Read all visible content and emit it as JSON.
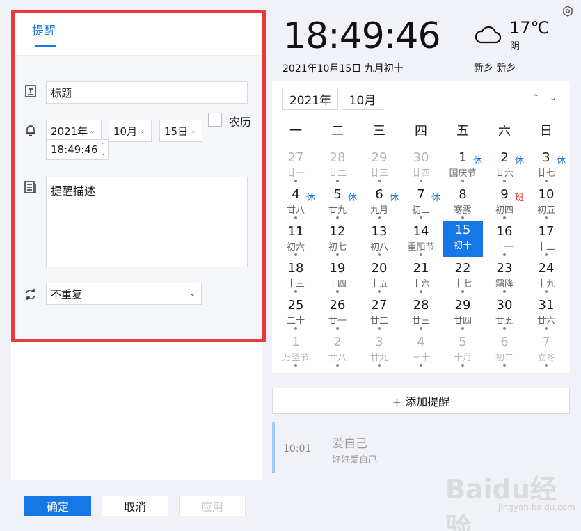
{
  "left": {
    "tab_label": "提醒",
    "title_value": "标题",
    "year_select": "2021年",
    "month_select": "10月",
    "day_select": "15日",
    "lunar_label": "农历",
    "time_value": "18:49:46",
    "description_value": "提醒描述",
    "repeat_value": "不重复"
  },
  "buttons": {
    "ok": "确定",
    "cancel": "取消",
    "apply": "应用"
  },
  "header": {
    "time": "18:49:46",
    "date": "2021年10月15日 九月初十",
    "temperature": "17℃",
    "weather": "阴",
    "location": "新乡 新乡"
  },
  "calendar": {
    "year": "2021年",
    "month": "10月",
    "weekdays": [
      "一",
      "二",
      "三",
      "四",
      "五",
      "六",
      "日"
    ],
    "days": [
      {
        "n": "27",
        "l": "廿一",
        "dim": true
      },
      {
        "n": "28",
        "l": "廿二",
        "dim": true
      },
      {
        "n": "29",
        "l": "廿三",
        "dim": true
      },
      {
        "n": "30",
        "l": "廿四",
        "dim": true
      },
      {
        "n": "1",
        "l": "国庆节",
        "tag": "休"
      },
      {
        "n": "2",
        "l": "廿六",
        "tag": "休"
      },
      {
        "n": "3",
        "l": "廿七",
        "tag": "休"
      },
      {
        "n": "4",
        "l": "廿八",
        "tag": "休"
      },
      {
        "n": "5",
        "l": "廿九",
        "tag": "休"
      },
      {
        "n": "6",
        "l": "九月",
        "tag": "休"
      },
      {
        "n": "7",
        "l": "初二",
        "tag": "休"
      },
      {
        "n": "8",
        "l": "寒露"
      },
      {
        "n": "9",
        "l": "初四",
        "tag": "班",
        "tag_color": "#e83a3a"
      },
      {
        "n": "10",
        "l": "初五"
      },
      {
        "n": "11",
        "l": "初六"
      },
      {
        "n": "12",
        "l": "初七"
      },
      {
        "n": "13",
        "l": "初八"
      },
      {
        "n": "14",
        "l": "重阳节"
      },
      {
        "n": "15",
        "l": "初十",
        "selected": true
      },
      {
        "n": "16",
        "l": "十一"
      },
      {
        "n": "17",
        "l": "十二"
      },
      {
        "n": "18",
        "l": "十三"
      },
      {
        "n": "19",
        "l": "十四"
      },
      {
        "n": "20",
        "l": "十五"
      },
      {
        "n": "21",
        "l": "十六"
      },
      {
        "n": "22",
        "l": "十七"
      },
      {
        "n": "23",
        "l": "霜降"
      },
      {
        "n": "24",
        "l": "十九"
      },
      {
        "n": "25",
        "l": "二十"
      },
      {
        "n": "26",
        "l": "廿一"
      },
      {
        "n": "27",
        "l": "廿二"
      },
      {
        "n": "28",
        "l": "廿三"
      },
      {
        "n": "29",
        "l": "廿四"
      },
      {
        "n": "30",
        "l": "廿五"
      },
      {
        "n": "31",
        "l": "廿六"
      },
      {
        "n": "1",
        "l": "万圣节",
        "dim": true
      },
      {
        "n": "2",
        "l": "廿八",
        "dim": true
      },
      {
        "n": "3",
        "l": "廿九",
        "dim": true
      },
      {
        "n": "4",
        "l": "三十",
        "dim": true
      },
      {
        "n": "5",
        "l": "十月",
        "dim": true
      },
      {
        "n": "6",
        "l": "初二",
        "dim": true
      },
      {
        "n": "7",
        "l": "立冬",
        "dim": true
      }
    ]
  },
  "add_reminder": "+ 添加提醒",
  "reminder": {
    "time": "10:01",
    "title": "爱自己",
    "subtitle": "好好爱自己"
  },
  "watermark": {
    "logo": "Baidu经验",
    "url": "jingyan.baidu.com"
  },
  "colors": {
    "accent": "#1677e6",
    "highlight_frame": "#e83a3a",
    "rest_day": "#1677e6",
    "work_day": "#e83a3a"
  }
}
